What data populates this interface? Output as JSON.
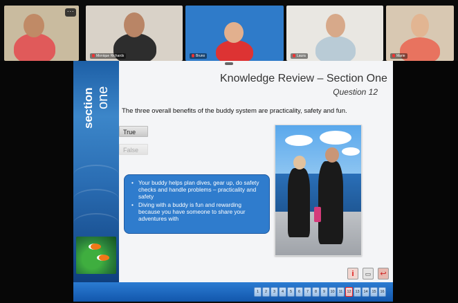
{
  "participants": [
    {
      "name": "",
      "bg": "#c7b79a"
    },
    {
      "name": "Monique Richards",
      "bg": "#d7cfc5"
    },
    {
      "name": "Bruno",
      "bg": "#2f7bc9"
    },
    {
      "name": "Laura",
      "bg": "#e8e6e1"
    },
    {
      "name": "Marie",
      "bg": "#d9c9b3"
    }
  ],
  "more_button": "···",
  "slide": {
    "side_word1": "section",
    "side_word2": "one",
    "title": "Knowledge Review – Section One",
    "subtitle": "Question 12",
    "question": "The three overall benefits of the buddy system are practicality, safety and fun.",
    "answers": {
      "true_label": "True",
      "false_label": "False"
    },
    "feedback": [
      "Your buddy helps plan dives, gear up, do safety checks and handle problems – practicality and safety",
      "Diving with a buddy is fun and rewarding because you have someone to share your adventures with"
    ],
    "controls": {
      "info": "i",
      "video": "▭",
      "exit": "↩"
    },
    "pages": [
      "1",
      "2",
      "3",
      "4",
      "5",
      "6",
      "7",
      "8",
      "9",
      "10",
      "11",
      "12",
      "13",
      "14",
      "15",
      "16"
    ],
    "current_page": "12"
  }
}
